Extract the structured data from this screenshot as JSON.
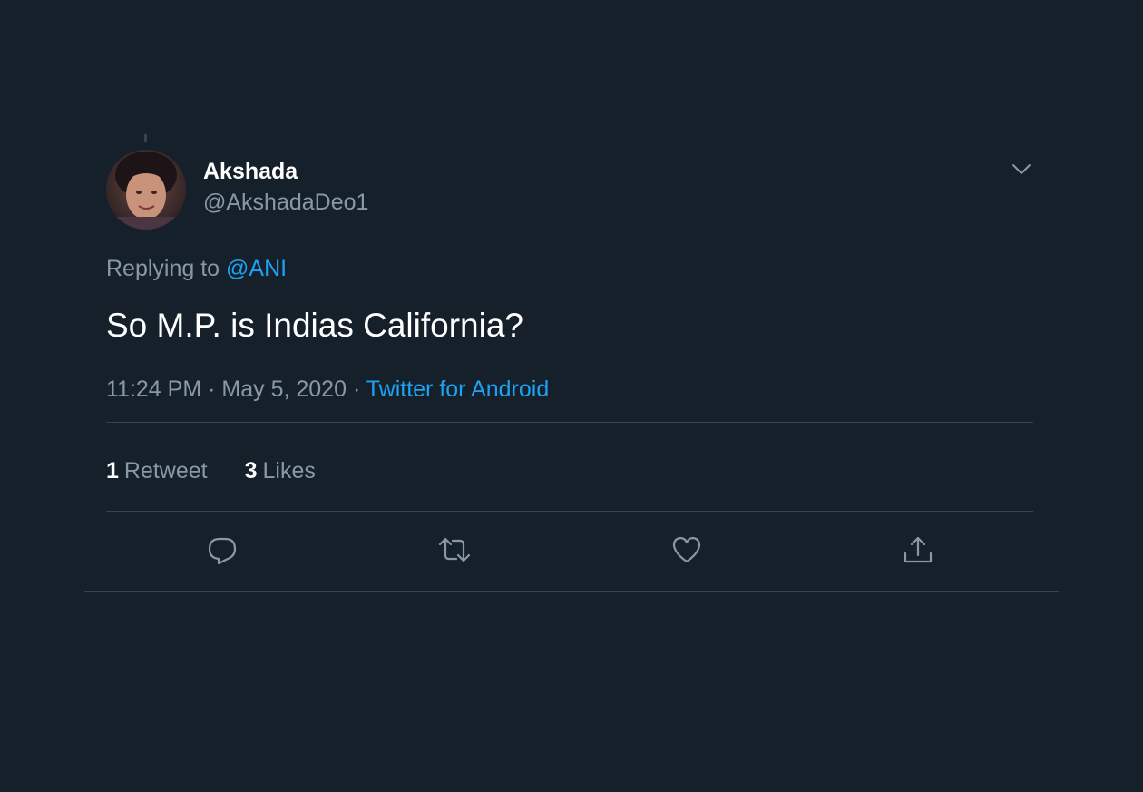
{
  "tweet": {
    "author": {
      "display_name": "Akshada",
      "handle": "@AkshadaDeo1"
    },
    "reply": {
      "prefix": "Replying to",
      "mention": "@ANI"
    },
    "text": "So M.P. is Indias California?",
    "meta": {
      "time": "11:24 PM",
      "separator": "·",
      "date": "May 5, 2020",
      "source": "Twitter for Android"
    },
    "stats": {
      "retweets_count": "1",
      "retweets_label": "Retweet",
      "likes_count": "3",
      "likes_label": "Likes"
    }
  },
  "icons": {
    "caret": "chevron-down-icon",
    "reply": "reply-icon",
    "retweet": "retweet-icon",
    "like": "heart-icon",
    "share": "share-icon"
  },
  "colors": {
    "background": "#15202b",
    "text_primary": "#ffffff",
    "text_secondary": "#8899a6",
    "accent": "#1da1f2",
    "divider": "#38444d"
  }
}
